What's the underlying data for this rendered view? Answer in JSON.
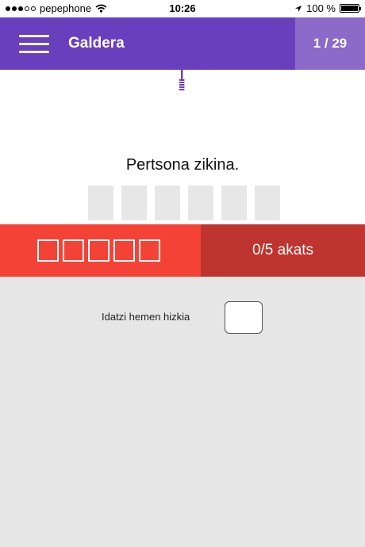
{
  "status_bar": {
    "carrier": "pepephone",
    "time": "10:26",
    "battery": "100 %",
    "signal_bars_filled": 3,
    "signal_bars_total": 5
  },
  "header": {
    "title": "Galdera",
    "counter": "1 / 29",
    "menu_icon": "hamburger-menu-icon"
  },
  "question": {
    "text": "Pertsona zikina.",
    "letter_count": 6
  },
  "mistakes": {
    "slots": 5,
    "label": "0/5 akats"
  },
  "input": {
    "label": "Idatzi hemen hizkia",
    "value": ""
  },
  "colors": {
    "header": "#6a3fbd",
    "counter_bg": "#8b6ac9",
    "mistakes_left": "#f44336",
    "mistakes_right": "#bf342e",
    "input_area_bg": "#e6e6e6"
  }
}
